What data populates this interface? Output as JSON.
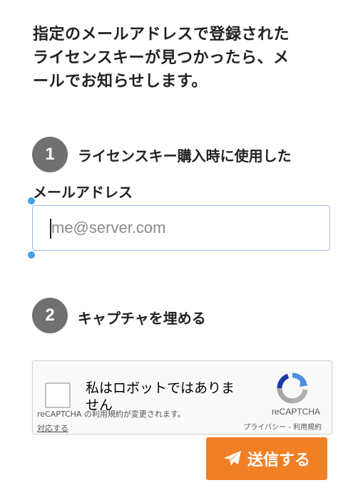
{
  "intro": {
    "line1": "指定のメールアドレスで登録された",
    "line2": "ライセンスキーが見つかったら、メ",
    "line3": "ールでお知らせします。"
  },
  "step1": {
    "number": "1",
    "title": "ライセンスキー購入時に使用した",
    "title_cont": "メールアドレス"
  },
  "email": {
    "value": "",
    "placeholder": "me@server.com"
  },
  "step2": {
    "number": "2",
    "title": "キャプチャを埋める"
  },
  "recaptcha": {
    "checkbox_label": "私はロボットではありません",
    "tos_notice": "reCAPTCHA の利用規約が変更されます。",
    "tos_action": "対応する",
    "brand": "reCAPTCHA",
    "links": "プライバシー - 利用規約"
  },
  "submit": {
    "label": "送信する",
    "icon": "paper-plane-icon",
    "color": "#f18024"
  },
  "colors": {
    "step_circle": "#707070",
    "input_border": "#9dbce0",
    "selection_handle": "#3fa3ea"
  }
}
